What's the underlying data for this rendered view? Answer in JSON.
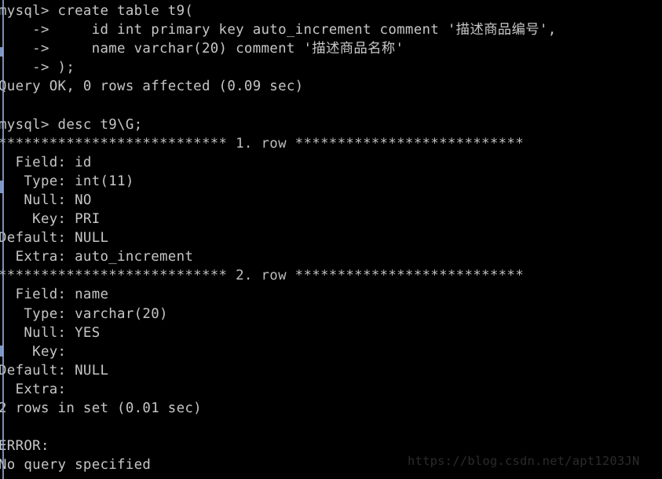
{
  "terminal": {
    "title": "mysql> console",
    "background_color": "#000000",
    "foreground_color": "#c6c6c6",
    "watermark_color": "#2b2b2b",
    "edge_color": "#8fa8d8",
    "prompt": "mysql>",
    "continuation_prompt": "->",
    "lines": [
      "mysql> create table t9(",
      "    ->     id int primary key auto_increment comment '描述商品编号',",
      "    ->     name varchar(20) comment '描述商品名称'",
      "    -> );",
      "Query OK, 0 rows affected (0.09 sec)",
      "",
      "mysql> desc t9\\G;",
      "*************************** 1. row ***************************",
      "  Field: id",
      "   Type: int(11)",
      "   Null: NO",
      "    Key: PRI",
      "Default: NULL",
      "  Extra: auto_increment",
      "*************************** 2. row ***************************",
      "  Field: name",
      "   Type: varchar(20)",
      "   Null: YES",
      "    Key: ",
      "Default: NULL",
      "  Extra: ",
      "2 rows in set (0.01 sec)",
      "",
      "ERROR:",
      "No query specified"
    ],
    "commands": [
      {
        "statement": "create table t9( id int primary key auto_increment comment '描述商品编号', name varchar(20) comment '描述商品名称' );",
        "result": "Query OK, 0 rows affected (0.09 sec)",
        "rows_affected": "0",
        "duration": "0.09 sec"
      },
      {
        "statement": "desc t9\\G;",
        "result": "2 rows in set (0.01 sec)",
        "row_count": "2",
        "duration": "0.01 sec",
        "error_header": "ERROR:",
        "error_message": "No query specified"
      }
    ],
    "describe_rows": [
      {
        "row_label": "1. row",
        "Field": "id",
        "Type": "int(11)",
        "Null": "NO",
        "Key": "PRI",
        "Default": "NULL",
        "Extra": "auto_increment"
      },
      {
        "row_label": "2. row",
        "Field": "name",
        "Type": "varchar(20)",
        "Null": "YES",
        "Key": "",
        "Default": "NULL",
        "Extra": ""
      }
    ],
    "watermark": "https://blog.csdn.net/apt1203JN"
  }
}
